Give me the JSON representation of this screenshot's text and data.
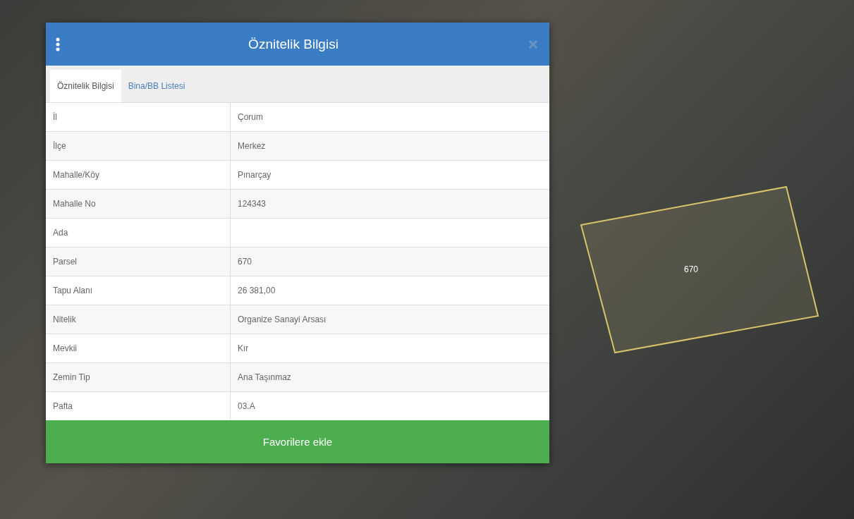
{
  "map": {
    "parcel": {
      "label": "670"
    }
  },
  "dialog": {
    "title": "Öznitelik Bilgisi",
    "tabs": [
      {
        "label": "Öznitelik Bilgisi",
        "selected": true
      },
      {
        "label": "Bina/BB Listesi",
        "selected": false
      }
    ],
    "rows": [
      {
        "name": "İl",
        "value": "Çorum"
      },
      {
        "name": "İlçe",
        "value": "Merkez"
      },
      {
        "name": "Mahalle/Köy",
        "value": "Pınarçay"
      },
      {
        "name": "Mahalle No",
        "value": "124343"
      },
      {
        "name": "Ada"
      },
      {
        "name": "Parsel",
        "value": "670"
      },
      {
        "name": "Tapu Alanı",
        "value": "26 381,00"
      },
      {
        "name": "Nitelik",
        "value": "Organize Sanayi Arsası"
      },
      {
        "name": "Mevkii",
        "value": "Kır"
      },
      {
        "name": "Zemin Tip",
        "value": "Ana Taşınmaz"
      },
      {
        "name": "Pafta",
        "value": "03.A"
      }
    ],
    "action_button": "Favorilere ekle"
  }
}
